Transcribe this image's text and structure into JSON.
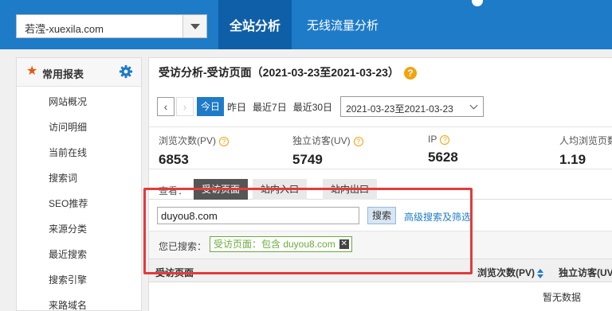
{
  "top_nav": {
    "site_selector_value": "若滢-xuexila.com",
    "tabs": [
      {
        "label": "全站分析",
        "active": true
      },
      {
        "label": "无线流量分析",
        "active": false
      }
    ],
    "brand_color": "#1e7bc8"
  },
  "sidebar": {
    "section_title": "常用报表",
    "items": [
      {
        "label": "网站概况"
      },
      {
        "label": "访问明细"
      },
      {
        "label": "当前在线"
      },
      {
        "label": "搜索词"
      },
      {
        "label": "SEO推荐"
      },
      {
        "label": "来源分类"
      },
      {
        "label": "最近搜索"
      },
      {
        "label": "搜索引擎"
      },
      {
        "label": "来路域名"
      }
    ]
  },
  "main": {
    "page_title": "受访分析-受访页面（2021-03-23至2021-03-23）",
    "date_shortcuts": [
      "今日",
      "昨日",
      "最近7日",
      "最近30日"
    ],
    "date_range_value": "2021-03-23至2021-03-23",
    "metrics": [
      {
        "label": "浏览次数(PV)",
        "value": "6853"
      },
      {
        "label": "独立访客(UV)",
        "value": "5749"
      },
      {
        "label": "IP",
        "value": "5628"
      },
      {
        "label": "人均浏览页数",
        "value": "1.19"
      }
    ],
    "view_label": "查看：",
    "view_tabs": [
      {
        "label": "受访页面",
        "active": true
      },
      {
        "label": "站内入口",
        "active": false
      },
      {
        "label": "站内出口",
        "active": false
      }
    ],
    "search_value": "duyou8.com",
    "search_button": "搜索",
    "advanced_link": "高级搜索及筛选",
    "searched_label": "您已搜索：",
    "searched_tag": "受访页面：包含 duyou8.com",
    "table_columns": [
      "受访页面",
      "浏览次数(PV)",
      "独立访客(UV"
    ],
    "no_data_text": "暂无数据"
  }
}
